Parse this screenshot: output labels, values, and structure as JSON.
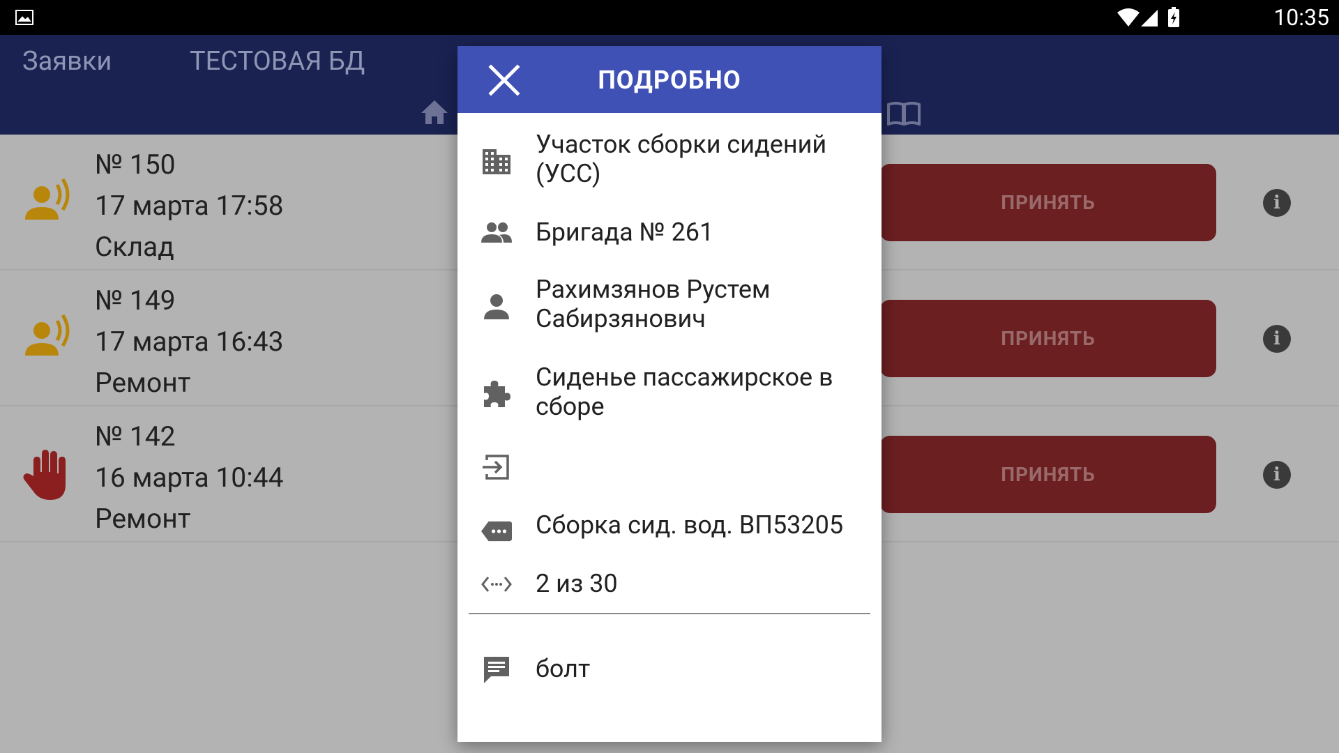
{
  "status_bar": {
    "time": "10:35"
  },
  "app_bar": {
    "tabs": [
      {
        "label": "Заявки"
      },
      {
        "label": "ТЕСТОВАЯ БД"
      }
    ]
  },
  "requests": [
    {
      "number": "№ 150",
      "datetime": "17 марта 17:58",
      "type": "Склад",
      "status_icon": "call-operator-icon",
      "accept_label": "ПРИНЯТЬ"
    },
    {
      "number": "№ 149",
      "datetime": "17 марта 16:43",
      "type": "Ремонт",
      "status_icon": "call-operator-icon",
      "accept_label": "ПРИНЯТЬ"
    },
    {
      "number": "№ 142",
      "datetime": "16 марта 10:44",
      "type": "Ремонт",
      "status_icon": "stop-hand-icon",
      "accept_label": "ПРИНЯТЬ"
    }
  ],
  "dialog": {
    "title": "ПОДРОБНО",
    "section": "Участок сборки сидений (УСС)",
    "brigade": "Бригада № 261",
    "person": "Рахимзянов Рустем Сабирзянович",
    "part": "Сиденье пассажирское в сборе",
    "exit_value": "",
    "operation": "Сборка сид. вод. ВП53205",
    "progress": "2 из 30",
    "comment": "болт"
  },
  "colors": {
    "app_bar": "#1a2252",
    "dialog_header": "#3f51b5",
    "accept_button": "#6c1f21",
    "warning_icon": "#b8860b",
    "stop_icon": "#8b1f1f"
  }
}
